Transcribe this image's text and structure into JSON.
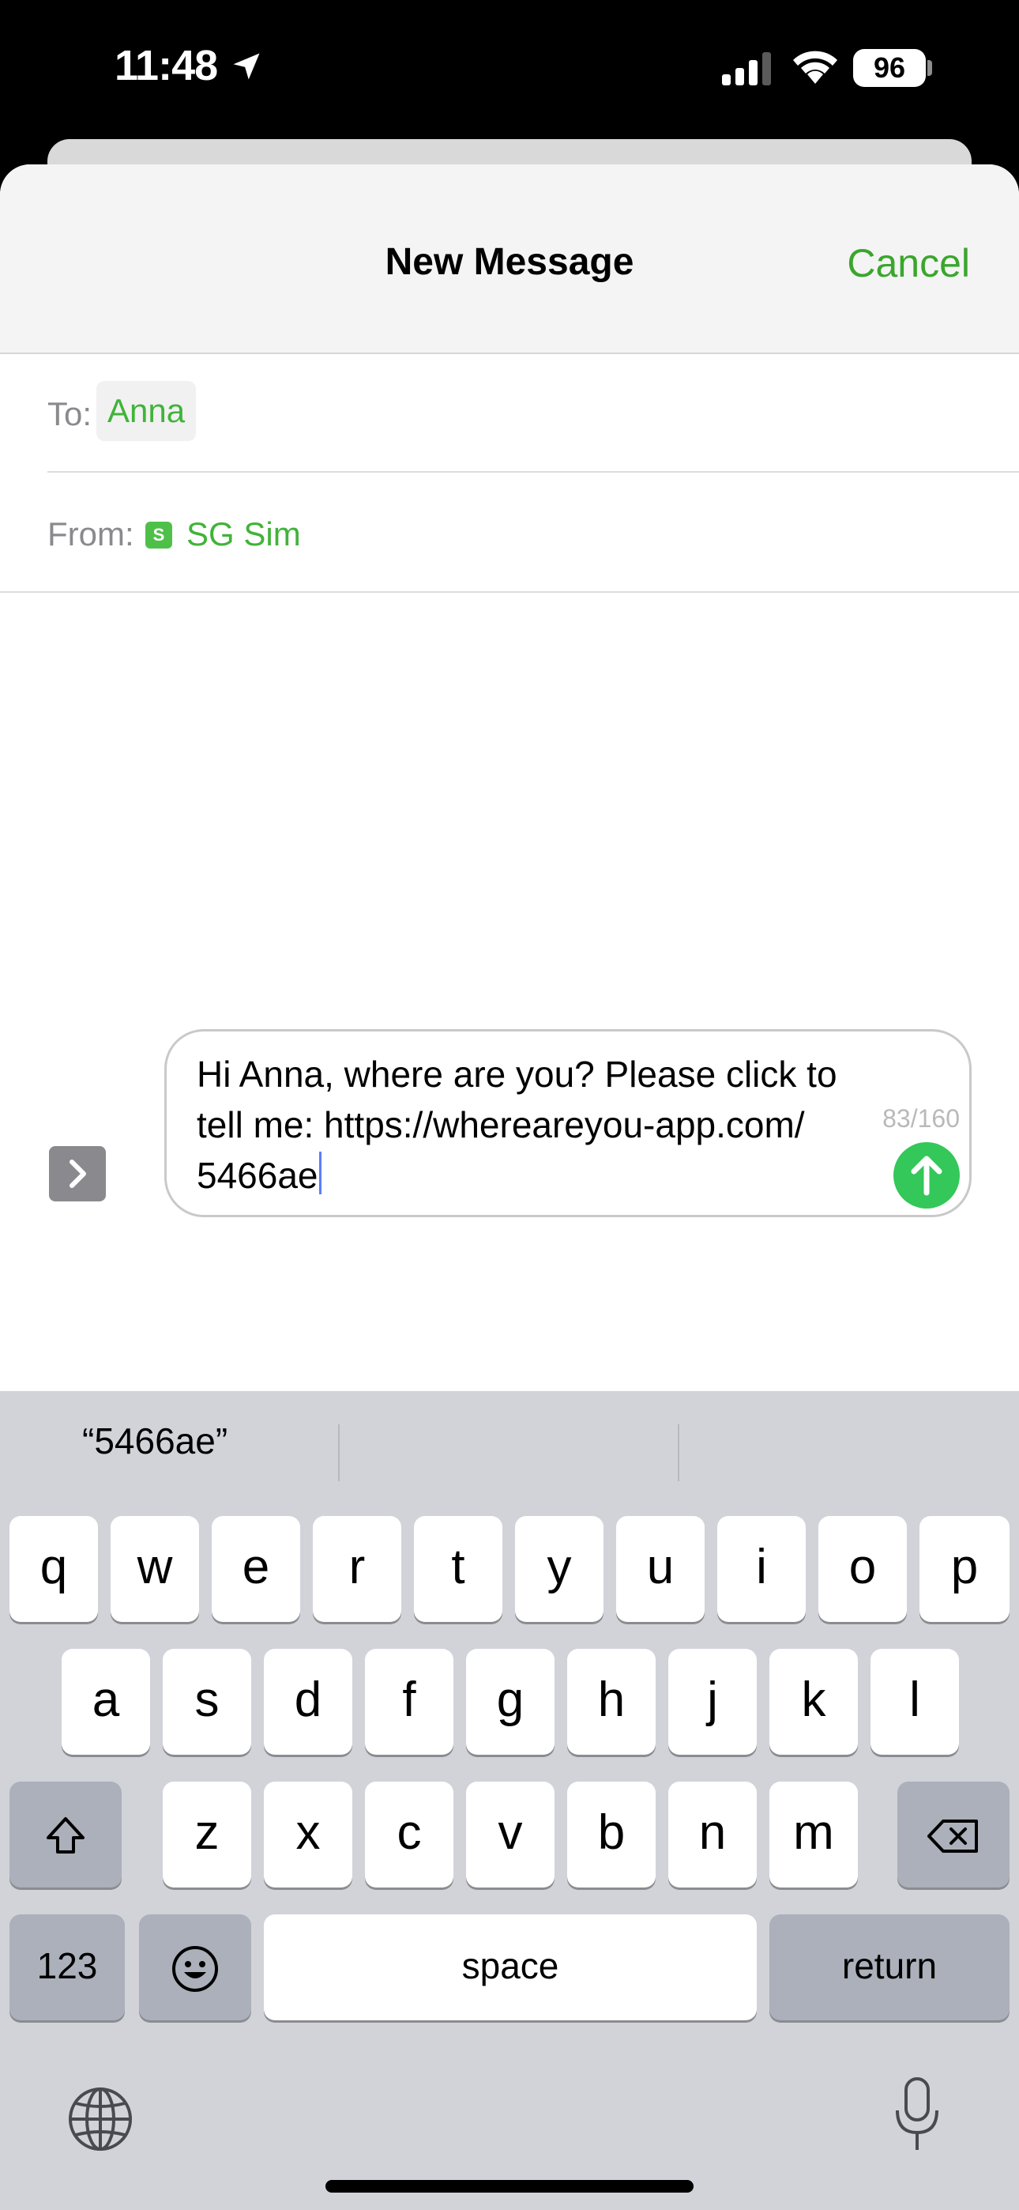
{
  "status": {
    "time": "11:48",
    "battery": "96"
  },
  "nav": {
    "title": "New Message",
    "cancel": "Cancel"
  },
  "to": {
    "label": "To:",
    "recipient": "Anna"
  },
  "from": {
    "label": "From:",
    "sim_badge": "S",
    "sim_name": "SG Sim"
  },
  "compose": {
    "text": "Hi Anna, where are you? Please click to\ntell me: https://whereareyou-app.com/\n5466ae",
    "count": "83/160"
  },
  "suggestions": [
    "“5466ae”",
    "",
    ""
  ],
  "keyboard": {
    "row1": [
      "q",
      "w",
      "e",
      "r",
      "t",
      "y",
      "u",
      "i",
      "o",
      "p"
    ],
    "row2": [
      "a",
      "s",
      "d",
      "f",
      "g",
      "h",
      "j",
      "k",
      "l"
    ],
    "row3": [
      "z",
      "x",
      "c",
      "v",
      "b",
      "n",
      "m"
    ],
    "numbers": "123",
    "space": "space",
    "return": "return"
  },
  "colors": {
    "accent": "#3aa62c",
    "send": "#34c759",
    "keyboard_bg": "#d1d3d9"
  },
  "icons": [
    "location-arrow-icon",
    "signal-icon",
    "wifi-icon",
    "chevron-right-icon",
    "send-arrow-icon",
    "shift-icon",
    "delete-icon",
    "emoji-icon",
    "globe-icon",
    "microphone-icon"
  ]
}
